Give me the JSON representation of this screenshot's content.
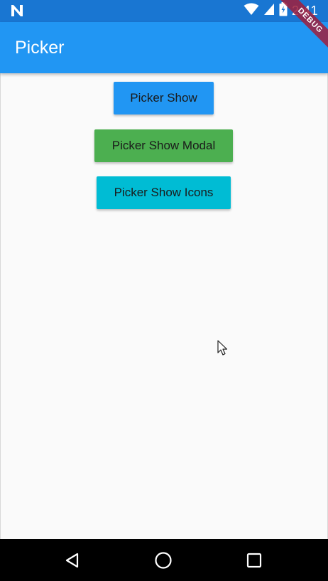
{
  "status_bar": {
    "time": "2:41",
    "left_icon": "n-notification-icon",
    "icons": [
      "wifi-icon",
      "signal-icon",
      "battery-charging-icon"
    ]
  },
  "app_bar": {
    "title": "Picker",
    "color": "#2196f3"
  },
  "debug_banner": {
    "label": "DEBUG"
  },
  "buttons": [
    {
      "label": "Picker Show",
      "color": "#2196f3"
    },
    {
      "label": "Picker Show Modal",
      "color": "#4caf50"
    },
    {
      "label": "Picker Show Icons",
      "color": "#00bcd4"
    }
  ],
  "nav_bar": {
    "icons": [
      "back-icon",
      "home-icon",
      "recents-icon"
    ]
  }
}
